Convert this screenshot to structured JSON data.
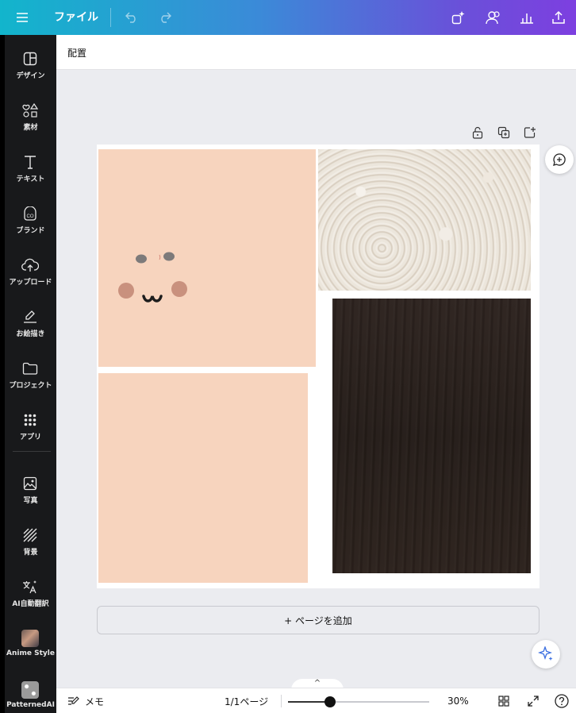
{
  "topbar": {
    "file_label": "ファイル",
    "icons": [
      "menu-icon",
      "undo-icon",
      "redo-icon",
      "magic-resize-icon",
      "share-people-icon",
      "insights-icon",
      "upload-share-icon"
    ]
  },
  "sidebar": {
    "items": [
      {
        "label": "デザイン",
        "icon": "design-icon"
      },
      {
        "label": "素材",
        "icon": "elements-icon"
      },
      {
        "label": "テキスト",
        "icon": "text-icon"
      },
      {
        "label": "ブランド",
        "icon": "brand-icon"
      },
      {
        "label": "アップロード",
        "icon": "upload-icon"
      },
      {
        "label": "お絵描き",
        "icon": "draw-icon"
      },
      {
        "label": "プロジェクト",
        "icon": "folder-icon"
      },
      {
        "label": "アプリ",
        "icon": "apps-icon"
      },
      {
        "label": "写真",
        "icon": "photo-icon"
      },
      {
        "label": "背景",
        "icon": "background-icon"
      },
      {
        "label": "AI自動翻訳",
        "icon": "translate-icon"
      },
      {
        "label": "Anime Style",
        "icon": "anime-style-app-icon"
      },
      {
        "label": "PatternedAI",
        "icon": "patterned-ai-app-icon"
      }
    ]
  },
  "header": {
    "title": "配置"
  },
  "canvas": {
    "add_page_label": "+ ページを追加"
  },
  "bottombar": {
    "memo_label": "メモ",
    "page_indicator": "1/1ページ",
    "zoom_label": "30%",
    "zoom_value": 0.3,
    "up_label": "^"
  },
  "colors": {
    "accent_gradient_start": "#12b5cc",
    "accent_gradient_end": "#7d3fe0",
    "rail": "#18191b",
    "peach": "#f7d4be"
  }
}
